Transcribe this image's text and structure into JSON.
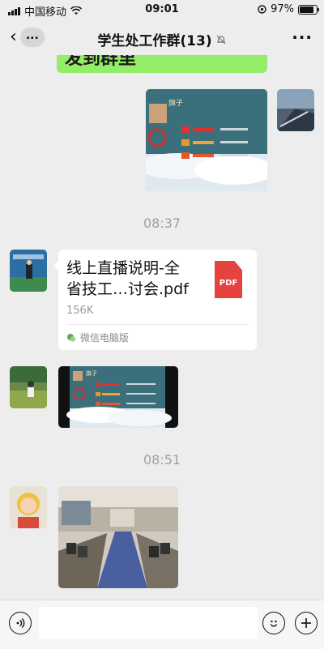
{
  "status_bar": {
    "carrier": "中国移动",
    "time": "09:01",
    "battery_percent": "97%",
    "battery_level": 0.97
  },
  "header": {
    "back_badge": "...",
    "title": "学生处工作群(13)",
    "mute_icon": "bell-mute-icon",
    "more_label": "···"
  },
  "chat": {
    "messages": [
      {
        "type": "text",
        "sender": "me",
        "partial_text": "发到群里"
      },
      {
        "type": "image",
        "sender": "me",
        "caption_in_image": "旗子"
      },
      {
        "type": "timestamp",
        "text": "08:37"
      },
      {
        "type": "file",
        "sender": "other",
        "file_name": "线上直播说明-全省技工…讨会.pdf",
        "file_name_line1": "线上直播说明-全",
        "file_name_line2": "省技工…讨会.pdf",
        "file_size": "156K",
        "source": "微信电脑版",
        "icon_label": "PDF"
      },
      {
        "type": "image",
        "sender": "other",
        "caption_in_image": "旗子"
      },
      {
        "type": "timestamp",
        "text": "08:51"
      },
      {
        "type": "image",
        "sender": "other",
        "description": "meeting room photo"
      }
    ]
  },
  "input_bar": {
    "voice_icon": "voice-icon",
    "emoji_icon": "emoji-icon",
    "plus_icon": "plus-icon",
    "input_value": ""
  }
}
